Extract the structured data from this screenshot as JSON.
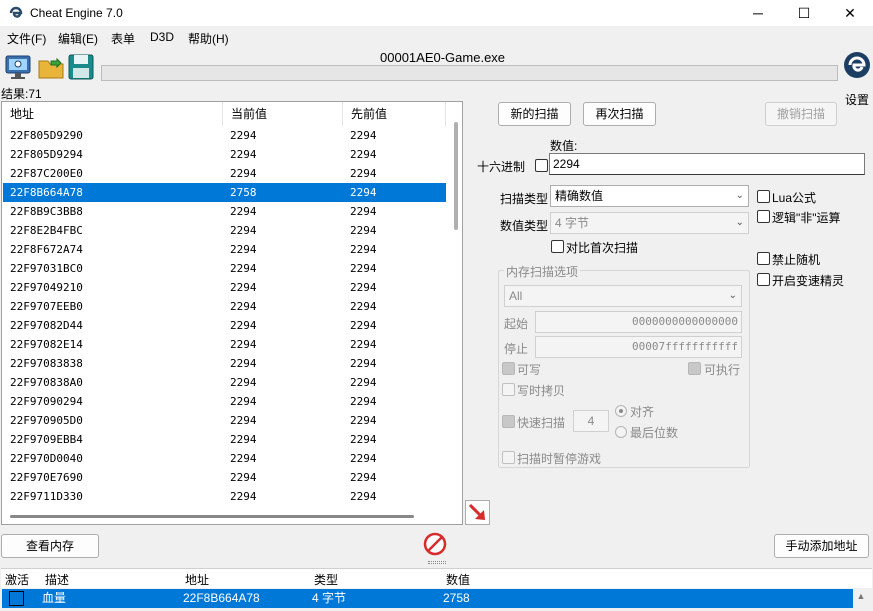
{
  "window": {
    "title": "Cheat Engine 7.0",
    "minimize": "─",
    "maximize": "☐",
    "close": "✕"
  },
  "menu": [
    "文件(F)",
    "编辑(E)",
    "表单",
    "D3D",
    "帮助(H)"
  ],
  "process_name": "00001AE0-Game.exe",
  "settings_label": "设置",
  "results_label": "结果:71",
  "columns": {
    "address": "地址",
    "current": "当前值",
    "previous": "先前值"
  },
  "rows": [
    {
      "address": "22F805D9290",
      "current": "2294",
      "previous": "2294"
    },
    {
      "address": "22F805D9294",
      "current": "2294",
      "previous": "2294"
    },
    {
      "address": "22F87C200E0",
      "current": "2294",
      "previous": "2294"
    },
    {
      "address": "22F8B664A78",
      "current": "2758",
      "previous": "2294"
    },
    {
      "address": "22F8B9C3BB8",
      "current": "2294",
      "previous": "2294"
    },
    {
      "address": "22F8E2B4FBC",
      "current": "2294",
      "previous": "2294"
    },
    {
      "address": "22F8F672A74",
      "current": "2294",
      "previous": "2294"
    },
    {
      "address": "22F97031BC0",
      "current": "2294",
      "previous": "2294"
    },
    {
      "address": "22F97049210",
      "current": "2294",
      "previous": "2294"
    },
    {
      "address": "22F9707EEB0",
      "current": "2294",
      "previous": "2294"
    },
    {
      "address": "22F97082D44",
      "current": "2294",
      "previous": "2294"
    },
    {
      "address": "22F97082E14",
      "current": "2294",
      "previous": "2294"
    },
    {
      "address": "22F97083838",
      "current": "2294",
      "previous": "2294"
    },
    {
      "address": "22F970838A0",
      "current": "2294",
      "previous": "2294"
    },
    {
      "address": "22F97090294",
      "current": "2294",
      "previous": "2294"
    },
    {
      "address": "22F970905D0",
      "current": "2294",
      "previous": "2294"
    },
    {
      "address": "22F9709EBB4",
      "current": "2294",
      "previous": "2294"
    },
    {
      "address": "22F970D0040",
      "current": "2294",
      "previous": "2294"
    },
    {
      "address": "22F970E7690",
      "current": "2294",
      "previous": "2294"
    },
    {
      "address": "22F9711D330",
      "current": "2294",
      "previous": "2294"
    }
  ],
  "selected_row_index": 3,
  "scan": {
    "new_scan": "新的扫描",
    "next_scan": "再次扫描",
    "undo_scan": "撤销扫描",
    "value_label": "数值:",
    "hex_label": "十六进制",
    "value": "2294",
    "scan_type_label": "扫描类型",
    "scan_type": "精确数值",
    "value_type_label": "数值类型",
    "value_type": "4 字节",
    "compare_first": "对比首次扫描",
    "lua": "Lua公式",
    "logic_not": "逻辑\"非\"运算",
    "no_random": "禁止随机",
    "speedhack": "开启变速精灵"
  },
  "memory_options": {
    "title": "内存扫描选项",
    "region": "All",
    "start_label": "起始",
    "start": "0000000000000000",
    "stop_label": "停止",
    "stop": "00007fffffffffff",
    "writable": "可写",
    "executable": "可执行",
    "copy_on_write": "写时拷贝",
    "fast_scan": "快速扫描",
    "fast_scan_value": "4",
    "align": "对齐",
    "last_digits": "最后位数",
    "pause_game": "扫描时暂停游戏"
  },
  "view_memory": "查看内存",
  "add_address": "手动添加地址",
  "table": {
    "headers": {
      "active": "激活",
      "description": "描述",
      "address": "地址",
      "type": "类型",
      "value": "数值"
    },
    "rows": [
      {
        "description": "血量",
        "address": "22F8B664A78",
        "type": "4 字节",
        "value": "2758"
      }
    ]
  },
  "colors": {
    "selection": "#0078d7",
    "accent_red": "#d82c2c"
  }
}
